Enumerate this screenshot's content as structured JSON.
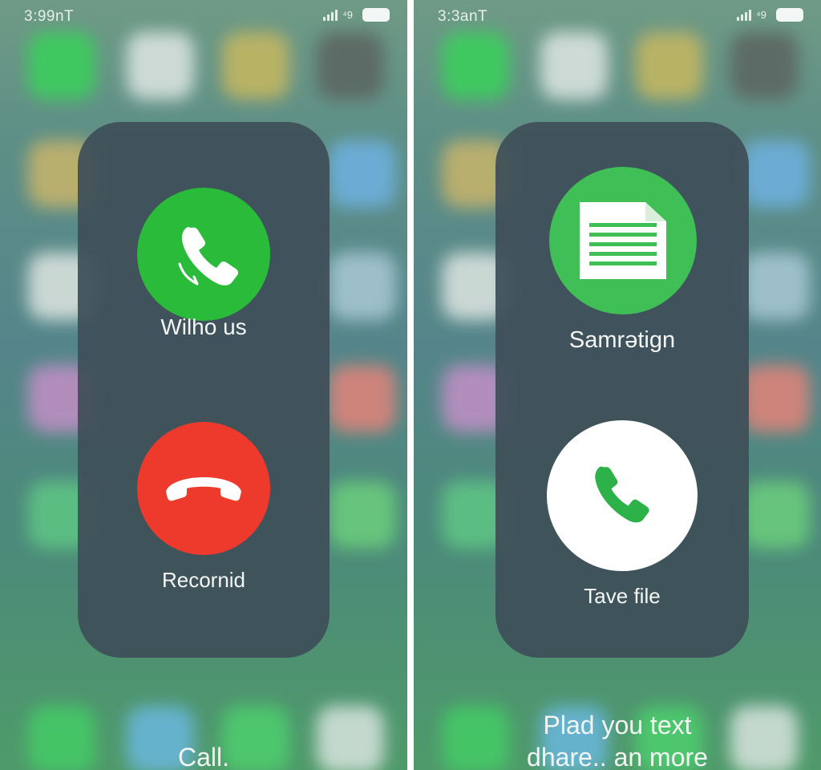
{
  "screens": [
    {
      "status_time": "3:99nT",
      "status_extra": "⁴9",
      "top_button_label": "Wilho us",
      "bottom_button_label": "Recornid",
      "bottom_text": "Call.",
      "colors": {
        "accept": "#2bbb3a",
        "decline": "#ee3a2c"
      },
      "icons": {
        "top": "phone-accept-icon",
        "bottom": "phone-hangup-icon"
      }
    },
    {
      "status_time": "3:3anT",
      "status_extra": "⁴9",
      "top_button_label": "Samrətign",
      "bottom_button_label": "Tave file",
      "bottom_text_line1": "Plad you text",
      "bottom_text_line2": "dhare.. an more",
      "colors": {
        "document_button": "#3fbf55",
        "white_button": "#ffffff",
        "phone_green": "#2db24a"
      },
      "icons": {
        "top": "document-icon",
        "bottom": "phone-icon"
      }
    }
  ]
}
